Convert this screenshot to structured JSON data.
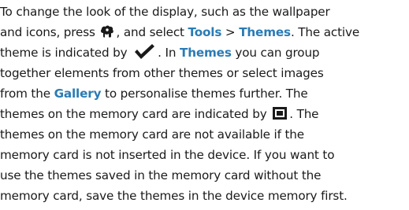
{
  "document": {
    "lines": [
      [
        "To change the look of the display, such as the wallpaper"
      ],
      [
        "and icons, press ",
        "{menu-key-icon}",
        ", and select ",
        "{kw:Tools}",
        " > ",
        "{kw:Themes}",
        ". The active"
      ],
      [
        "theme is indicated by ",
        "{check-icon}",
        ". In ",
        "{kw:Themes}",
        " you can group"
      ],
      [
        "together elements from other themes or select images"
      ],
      [
        "from the ",
        "{kw:Gallery}",
        " to personalise themes further. The"
      ],
      [
        "themes on the memory card are indicated by ",
        "{memcard-icon}",
        ". The"
      ],
      [
        "themes on the memory card are not available if the"
      ],
      [
        "memory card is not inserted in the device. If you want to"
      ],
      [
        "use the themes saved in the memory card without the"
      ],
      [
        "memory card, save the themes in the device memory first."
      ]
    ]
  },
  "icons": {
    "menu_key": "menu-key-icon",
    "check": "check-icon",
    "memory_card": "memory-card-icon"
  },
  "colors": {
    "text": "#1a1a1a",
    "keyword": "#2a7bb5"
  }
}
